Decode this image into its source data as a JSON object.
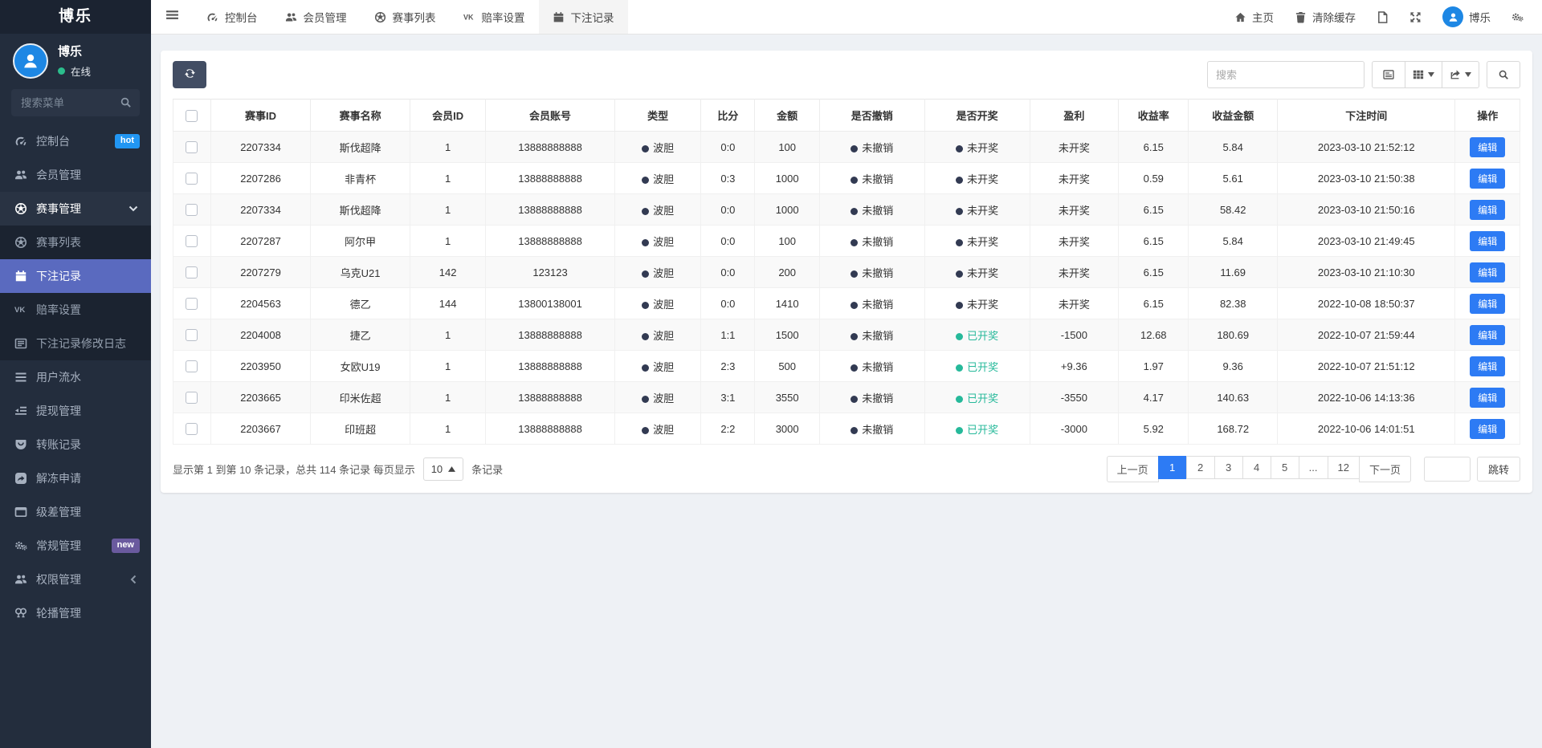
{
  "app": {
    "brand": "博乐"
  },
  "colors": {
    "accent_blue": "#2d7bf4",
    "menu_active": "#5a6abf",
    "status_green": "#26b99a",
    "status_dark": "#323a52",
    "hot_badge": "#2196f3",
    "new_badge": "#6a5a9e",
    "online_dot": "#2bbd8c",
    "avatar_blue": "#1d87e4",
    "sidebar_bg": "#232d3d"
  },
  "sidebar": {
    "user": {
      "name": "博乐",
      "status": "在线"
    },
    "search_placeholder": "搜索菜单",
    "items": [
      {
        "id": "console",
        "label": "控制台",
        "icon": "dashboard-icon",
        "badge": "hot",
        "badge_color": "#2196f3"
      },
      {
        "id": "members",
        "label": "会员管理",
        "icon": "users-icon"
      },
      {
        "id": "matches",
        "label": "赛事管理",
        "icon": "soccer-icon",
        "children": [
          {
            "id": "match-list",
            "label": "赛事列表",
            "icon": "soccer-icon"
          },
          {
            "id": "bet-records",
            "label": "下注记录",
            "icon": "calendar-icon",
            "active": true
          },
          {
            "id": "odds-settings",
            "label": "赔率设置",
            "icon": "vk-icon"
          },
          {
            "id": "bet-record-logs",
            "label": "下注记录修改日志",
            "icon": "list-icon"
          }
        ]
      },
      {
        "id": "user-flow",
        "label": "用户流水",
        "icon": "bars-icon"
      },
      {
        "id": "withdraw",
        "label": "提现管理",
        "icon": "withdraw-icon"
      },
      {
        "id": "transfer-records",
        "label": "转账记录",
        "icon": "transfer-icon"
      },
      {
        "id": "unfreeze-requests",
        "label": "解冻申请",
        "icon": "unfreeze-icon"
      },
      {
        "id": "level-diff",
        "label": "级差管理",
        "icon": "window-icon"
      },
      {
        "id": "general",
        "label": "常规管理",
        "icon": "gears-icon",
        "badge": "new",
        "badge_color": "#6a5a9e"
      },
      {
        "id": "permissions",
        "label": "权限管理",
        "icon": "users-icon",
        "collapsed": true
      },
      {
        "id": "carousel",
        "label": "轮播管理",
        "icon": "carousel-icon"
      }
    ]
  },
  "topnav": {
    "tabs": [
      {
        "id": "console",
        "label": "控制台",
        "icon": "dashboard-icon"
      },
      {
        "id": "members",
        "label": "会员管理",
        "icon": "users-icon"
      },
      {
        "id": "match-list",
        "label": "赛事列表",
        "icon": "soccer-icon"
      },
      {
        "id": "odds-settings",
        "label": "赔率设置",
        "icon": "vk-icon"
      },
      {
        "id": "bet-records",
        "label": "下注记录",
        "icon": "calendar-icon",
        "active": true
      }
    ],
    "right": [
      {
        "id": "home",
        "label": "主页",
        "icon": "home-icon"
      },
      {
        "id": "clear-cache",
        "label": "清除缓存",
        "icon": "trash-icon"
      },
      {
        "id": "log",
        "label": "",
        "icon": "file-icon"
      },
      {
        "id": "fullscreen",
        "label": "",
        "icon": "expand-icon"
      },
      {
        "id": "profile",
        "label": "博乐",
        "icon": "avatar"
      },
      {
        "id": "settings",
        "label": "",
        "icon": "gears-icon"
      }
    ]
  },
  "toolbar": {
    "search_placeholder": "搜索"
  },
  "table": {
    "columns": [
      "赛事ID",
      "赛事名称",
      "会员ID",
      "会员账号",
      "类型",
      "比分",
      "金额",
      "是否撤销",
      "是否开奖",
      "盈利",
      "收益率",
      "收益金额",
      "下注时间",
      "操作"
    ],
    "edit_label": "编辑",
    "rows": [
      {
        "match_id": "2207334",
        "match_name": "斯伐超降",
        "member_id": "1",
        "account": "13888888888",
        "type": "波胆",
        "score": "0:0",
        "amount": "100",
        "cancel": "未撤销",
        "draw": "未开奖",
        "draw_green": false,
        "profit": "未开奖",
        "rate": "6.15",
        "income": "5.84",
        "time": "2023-03-10 21:52:12"
      },
      {
        "match_id": "2207286",
        "match_name": "非青杯",
        "member_id": "1",
        "account": "13888888888",
        "type": "波胆",
        "score": "0:3",
        "amount": "1000",
        "cancel": "未撤销",
        "draw": "未开奖",
        "draw_green": false,
        "profit": "未开奖",
        "rate": "0.59",
        "income": "5.61",
        "time": "2023-03-10 21:50:38"
      },
      {
        "match_id": "2207334",
        "match_name": "斯伐超降",
        "member_id": "1",
        "account": "13888888888",
        "type": "波胆",
        "score": "0:0",
        "amount": "1000",
        "cancel": "未撤销",
        "draw": "未开奖",
        "draw_green": false,
        "profit": "未开奖",
        "rate": "6.15",
        "income": "58.42",
        "time": "2023-03-10 21:50:16"
      },
      {
        "match_id": "2207287",
        "match_name": "阿尔甲",
        "member_id": "1",
        "account": "13888888888",
        "type": "波胆",
        "score": "0:0",
        "amount": "100",
        "cancel": "未撤销",
        "draw": "未开奖",
        "draw_green": false,
        "profit": "未开奖",
        "rate": "6.15",
        "income": "5.84",
        "time": "2023-03-10 21:49:45"
      },
      {
        "match_id": "2207279",
        "match_name": "乌克U21",
        "member_id": "142",
        "account": "123123",
        "type": "波胆",
        "score": "0:0",
        "amount": "200",
        "cancel": "未撤销",
        "draw": "未开奖",
        "draw_green": false,
        "profit": "未开奖",
        "rate": "6.15",
        "income": "11.69",
        "time": "2023-03-10 21:10:30"
      },
      {
        "match_id": "2204563",
        "match_name": "德乙",
        "member_id": "144",
        "account": "13800138001",
        "type": "波胆",
        "score": "0:0",
        "amount": "1410",
        "cancel": "未撤销",
        "draw": "未开奖",
        "draw_green": false,
        "profit": "未开奖",
        "rate": "6.15",
        "income": "82.38",
        "time": "2022-10-08 18:50:37"
      },
      {
        "match_id": "2204008",
        "match_name": "捷乙",
        "member_id": "1",
        "account": "13888888888",
        "type": "波胆",
        "score": "1:1",
        "amount": "1500",
        "cancel": "未撤销",
        "draw": "已开奖",
        "draw_green": true,
        "profit": "-1500",
        "rate": "12.68",
        "income": "180.69",
        "time": "2022-10-07 21:59:44"
      },
      {
        "match_id": "2203950",
        "match_name": "女欧U19",
        "member_id": "1",
        "account": "13888888888",
        "type": "波胆",
        "score": "2:3",
        "amount": "500",
        "cancel": "未撤销",
        "draw": "已开奖",
        "draw_green": true,
        "profit": "+9.36",
        "rate": "1.97",
        "income": "9.36",
        "time": "2022-10-07 21:51:12"
      },
      {
        "match_id": "2203665",
        "match_name": "印米佐超",
        "member_id": "1",
        "account": "13888888888",
        "type": "波胆",
        "score": "3:1",
        "amount": "3550",
        "cancel": "未撤销",
        "draw": "已开奖",
        "draw_green": true,
        "profit": "-3550",
        "rate": "4.17",
        "income": "140.63",
        "time": "2022-10-06 14:13:36"
      },
      {
        "match_id": "2203667",
        "match_name": "印班超",
        "member_id": "1",
        "account": "13888888888",
        "type": "波胆",
        "score": "2:2",
        "amount": "3000",
        "cancel": "未撤销",
        "draw": "已开奖",
        "draw_green": true,
        "profit": "-3000",
        "rate": "5.92",
        "income": "168.72",
        "time": "2022-10-06 14:01:51"
      }
    ]
  },
  "pagination": {
    "summary_before": "显示第 1 到第 10 条记录，总共 114 条记录 每页显示",
    "page_size": "10",
    "summary_after": "条记录",
    "prev_label": "上一页",
    "next_label": "下一页",
    "pages": [
      "1",
      "2",
      "3",
      "4",
      "5",
      "...",
      "12"
    ],
    "active_page": "1",
    "jump_label": "跳转"
  }
}
